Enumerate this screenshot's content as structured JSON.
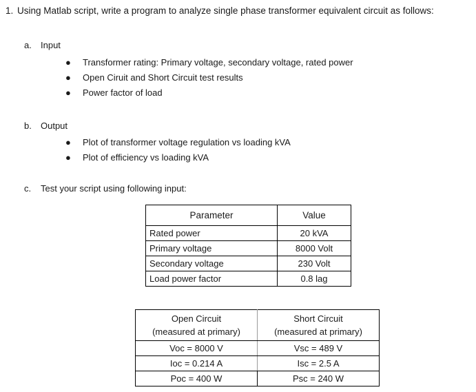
{
  "question": {
    "number": "1.",
    "stem": "Using Matlab script, write a program to analyze single phase transformer equivalent circuit as follows:",
    "parts": [
      {
        "letter": "a.",
        "title": "Input",
        "bullets": [
          "Transformer rating: Primary voltage, secondary voltage, rated power",
          "Open Ciruit and Short Circuit test results",
          "Power factor of load"
        ]
      },
      {
        "letter": "b.",
        "title": "Output",
        "bullets": [
          "Plot of transformer voltage regulation vs loading kVA",
          "Plot of efficiency vs loading kVA"
        ]
      },
      {
        "letter": "c.",
        "title": "Test your script using following input:",
        "bullets": []
      }
    ]
  },
  "bullet_glyph": "●",
  "param_table": {
    "headers": [
      "Parameter",
      "Value"
    ],
    "rows": [
      [
        "Rated power",
        "20 kVA"
      ],
      [
        "Primary voltage",
        "8000 Volt"
      ],
      [
        "Secondary voltage",
        "230 Volt"
      ],
      [
        "Load power factor",
        "0.8 lag"
      ]
    ]
  },
  "test_table": {
    "headers": [
      {
        "line1": "Open Circuit",
        "line2": "(measured at primary)"
      },
      {
        "line1": "Short Circuit",
        "line2": "(measured at primary)"
      }
    ],
    "rows": [
      [
        "Voc = 8000 V",
        "Vsc = 489 V"
      ],
      [
        "Ioc = 0.214 A",
        "Isc = 2.5 A"
      ],
      [
        "Poc = 400 W",
        "Psc = 240 W"
      ]
    ]
  }
}
